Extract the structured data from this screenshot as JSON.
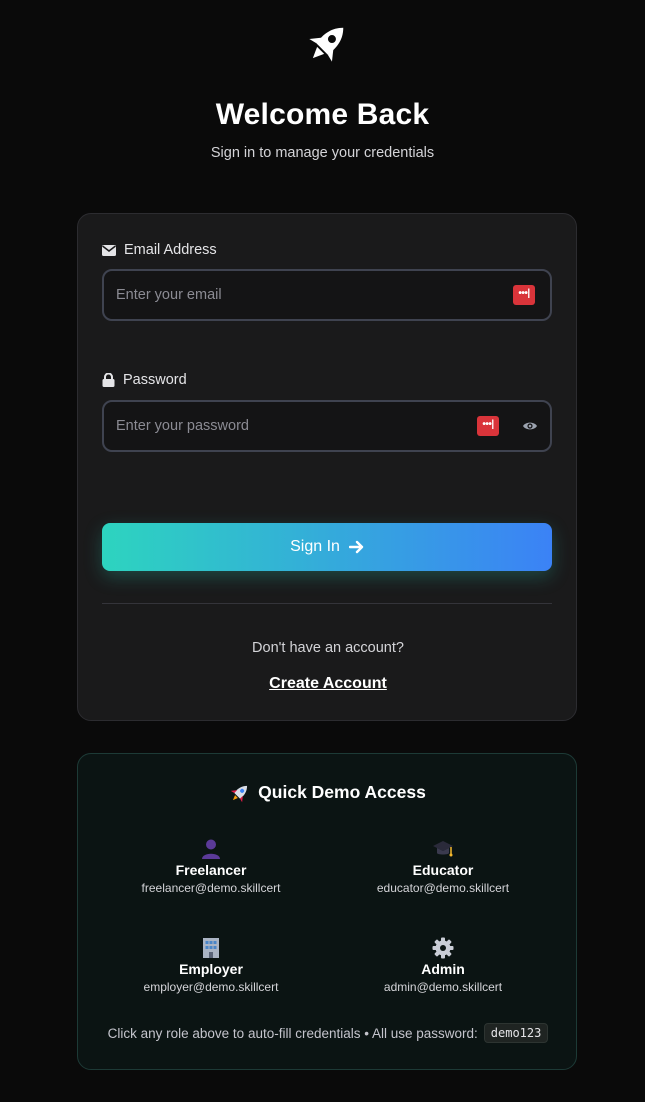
{
  "header": {
    "logo_icon": "rocket-icon",
    "title": "Welcome Back",
    "subtitle": "Sign in to manage your credentials"
  },
  "login_form": {
    "email": {
      "label": "Email Address",
      "label_icon": "envelope-icon",
      "placeholder": "Enter your email",
      "value": ""
    },
    "password": {
      "label": "Password",
      "label_icon": "lock-icon",
      "placeholder": "Enter your password",
      "value": "",
      "toggle_icon": "eye-icon"
    },
    "password_manager_badge": "•••|",
    "signin_label": "Sign In",
    "signin_icon": "arrow-right-icon",
    "no_account_text": "Don't have an account?",
    "create_account_label": "Create Account"
  },
  "demo": {
    "title": "Quick Demo Access",
    "title_icon": "rocket-emoji-icon",
    "roles": [
      {
        "name": "Freelancer",
        "email": "freelancer@demo.skillcert",
        "icon": "person-icon"
      },
      {
        "name": "Educator",
        "email": "educator@demo.skillcert",
        "icon": "graduation-cap-icon"
      },
      {
        "name": "Employer",
        "email": "employer@demo.skillcert",
        "icon": "office-building-icon"
      },
      {
        "name": "Admin",
        "email": "admin@demo.skillcert",
        "icon": "gear-icon"
      }
    ],
    "hint_text": "Click any role above to auto-fill credentials • All use password:",
    "demo_password": "demo123"
  },
  "colors": {
    "background": "#0a0a0a",
    "card": "#1a1a1b",
    "gradient_start": "#2dd4bf",
    "gradient_end": "#3b82f6",
    "password_badge": "#d9343a"
  }
}
